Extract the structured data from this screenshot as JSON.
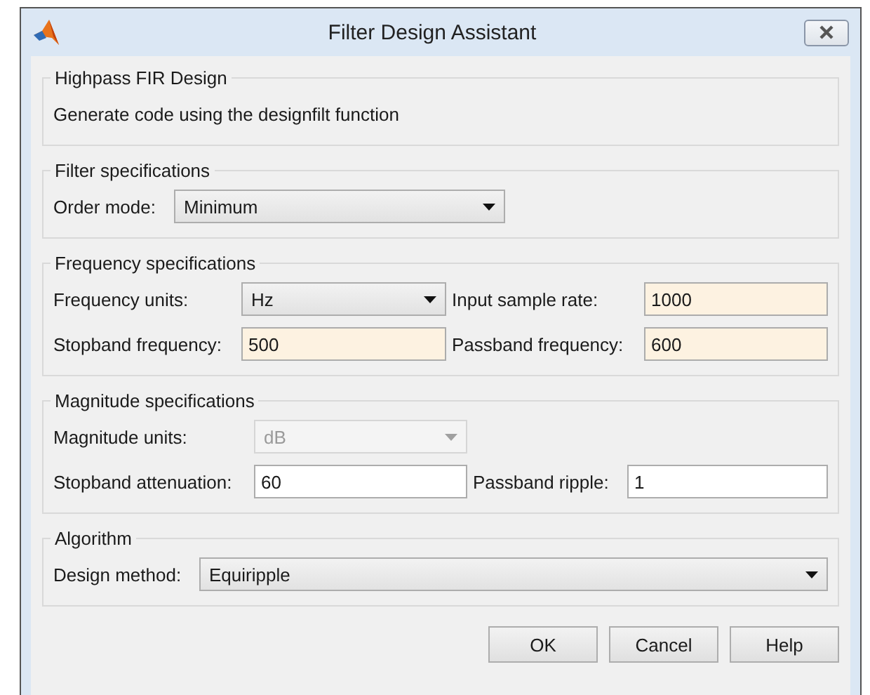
{
  "window": {
    "title": "Filter Design Assistant"
  },
  "sections": [
    {
      "title": "Highpass FIR Design",
      "rows": [
        [
          {
            "kind": "text",
            "text": "Generate code using the designfilt function"
          }
        ]
      ]
    },
    {
      "title": "Filter specifications",
      "rows": [
        [
          {
            "kind": "label",
            "text": "Order mode:"
          },
          {
            "kind": "dropdown",
            "value": "Minimum",
            "disabled": false
          }
        ]
      ]
    },
    {
      "title": "Frequency specifications",
      "rows": [
        [
          {
            "kind": "label",
            "text": "Frequency units:"
          },
          {
            "kind": "dropdown",
            "value": "Hz",
            "disabled": false
          },
          {
            "kind": "label",
            "text": "Input sample rate:"
          },
          {
            "kind": "field",
            "value": "1000",
            "highlighted": true
          }
        ],
        [
          {
            "kind": "label",
            "text": "Stopband frequency:"
          },
          {
            "kind": "field",
            "value": "500",
            "highlighted": true
          },
          {
            "kind": "label",
            "text": "Passband frequency:"
          },
          {
            "kind": "field",
            "value": "600",
            "highlighted": true
          }
        ]
      ]
    },
    {
      "title": "Magnitude specifications",
      "rows": [
        [
          {
            "kind": "label",
            "text": "Magnitude units:"
          },
          {
            "kind": "dropdown",
            "value": "dB",
            "disabled": true
          }
        ],
        [
          {
            "kind": "label",
            "text": "Stopband attenuation:"
          },
          {
            "kind": "field",
            "value": "60",
            "highlighted": false
          },
          {
            "kind": "label",
            "text": "Passband ripple:"
          },
          {
            "kind": "field",
            "value": "1",
            "highlighted": false
          }
        ]
      ]
    },
    {
      "title": "Algorithm",
      "rows": [
        [
          {
            "kind": "label",
            "text": "Design method:"
          },
          {
            "kind": "dropdown",
            "value": "Equiripple",
            "disabled": false
          }
        ]
      ]
    }
  ],
  "buttons": [
    "OK",
    "Cancel",
    "Help"
  ]
}
